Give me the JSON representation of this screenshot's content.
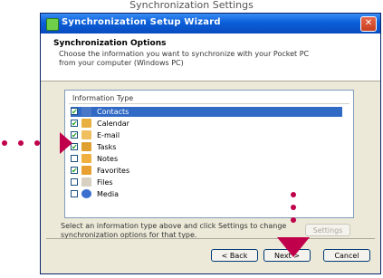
{
  "caption": "Synchronization Settings",
  "window": {
    "title": "Synchronization Setup Wizard",
    "close_icon": "close-icon"
  },
  "header": {
    "title": "Synchronization Options",
    "description": "Choose the information you want to synchronize with your Pocket PC from your computer (Windows PC)"
  },
  "list": {
    "column_header": "Information Type",
    "items": [
      {
        "label": "Contacts",
        "checked": true,
        "selected": true,
        "icon": "contacts-icon",
        "color": "#4a78c8"
      },
      {
        "label": "Calendar",
        "checked": true,
        "selected": false,
        "icon": "calendar-icon",
        "color": "#e8b040"
      },
      {
        "label": "E-mail",
        "checked": true,
        "selected": false,
        "icon": "email-icon",
        "color": "#f0c060"
      },
      {
        "label": "Tasks",
        "checked": true,
        "selected": false,
        "icon": "tasks-icon",
        "color": "#e0a030"
      },
      {
        "label": "Notes",
        "checked": false,
        "selected": false,
        "icon": "notes-icon",
        "color": "#f0b040"
      },
      {
        "label": "Favorites",
        "checked": true,
        "selected": false,
        "icon": "favorites-icon",
        "color": "#e8a030"
      },
      {
        "label": "Files",
        "checked": false,
        "selected": false,
        "icon": "files-icon",
        "color": "#d8d0c0"
      },
      {
        "label": "Media",
        "checked": false,
        "selected": false,
        "icon": "media-icon",
        "color": "#3a6fd0"
      }
    ]
  },
  "footer": {
    "hint": "Select an information type above and click Settings to change synchronization options for that type.",
    "settings_button": "Settings",
    "back_button": "< Back",
    "next_button": "Next >",
    "cancel_button": "Cancel"
  },
  "accent_color": "#c0004a"
}
